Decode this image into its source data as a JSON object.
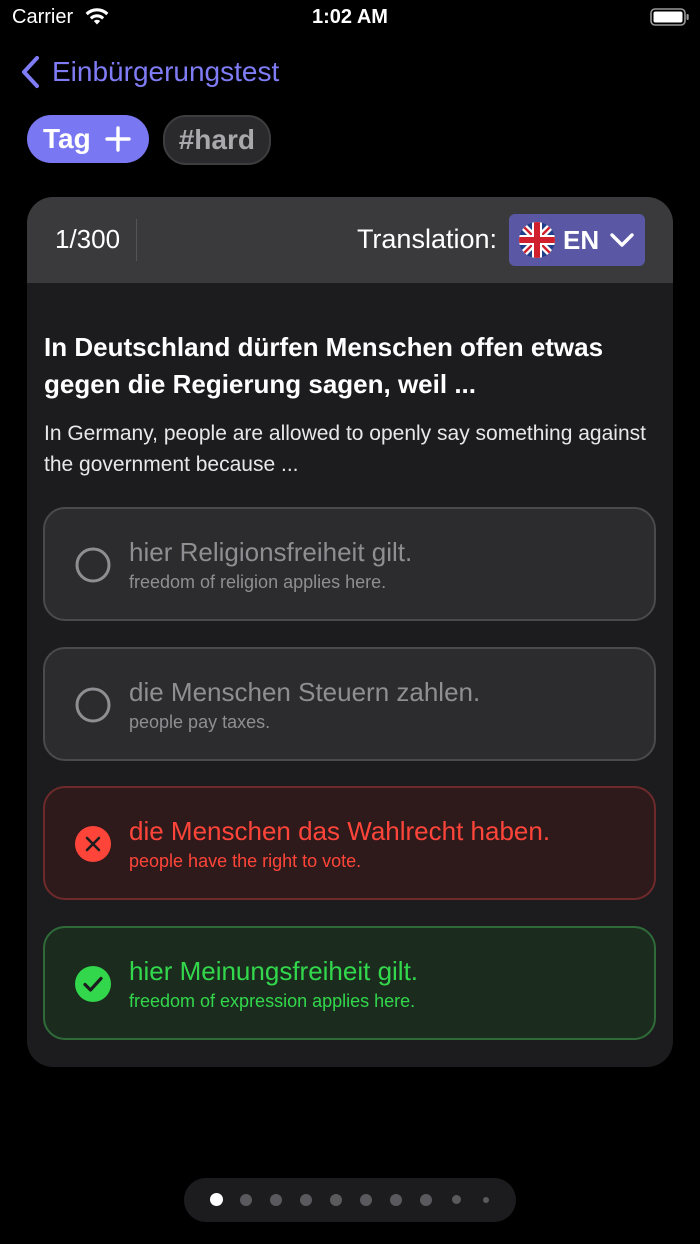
{
  "status_bar": {
    "carrier": "Carrier",
    "time": "1:02 AM"
  },
  "nav": {
    "back_label": "Einbürgerungstest"
  },
  "tags": {
    "add_label": "Tag",
    "chips": [
      "#hard"
    ]
  },
  "card": {
    "counter": "1/300",
    "translation_label": "Translation:",
    "language": "EN",
    "question": "In Deutschland dürfen Menschen offen etwas gegen die Regierung sagen, weil ...",
    "question_translation": "In Germany, people are allowed to openly say something against the government because ...",
    "answers": [
      {
        "text": "hier Religionsfreiheit gilt.",
        "translation": "freedom of religion applies here.",
        "state": "neutral"
      },
      {
        "text": "die Menschen Steuern zahlen.",
        "translation": "people pay taxes.",
        "state": "neutral"
      },
      {
        "text": "die Menschen das Wahlrecht haben.",
        "translation": "people have the right to vote.",
        "state": "wrong"
      },
      {
        "text": "hier Meinungsfreiheit gilt.",
        "translation": "freedom of expression applies here.",
        "state": "correct"
      }
    ]
  },
  "pager": {
    "total_dots": 10,
    "active_index": 0
  },
  "colors": {
    "accent": "#7a77f2",
    "wrong": "#ff453a",
    "correct": "#32d74b",
    "card_bg": "#1c1c1e"
  }
}
